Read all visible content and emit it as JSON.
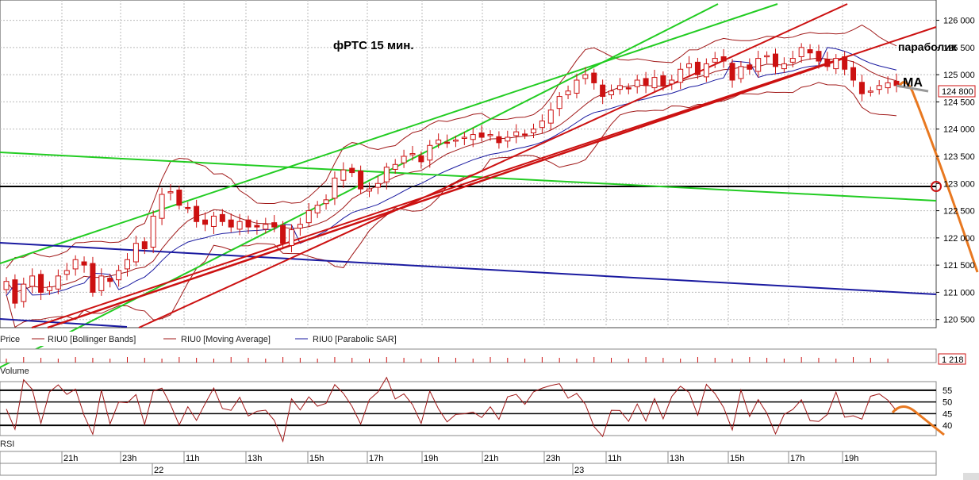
{
  "chart_data": {
    "type": "candlestick",
    "title": "фРТС   15 мин.",
    "annotations": {
      "parabolic": "параболик",
      "ma": "МА"
    },
    "price_axis": {
      "ylim": [
        120350,
        126300
      ],
      "ticks": [
        "126 000",
        "125 500",
        "125 000",
        "124 500",
        "124 000",
        "123 500",
        "123 000",
        "122 500",
        "122 000",
        "121 500",
        "121 000",
        "120 500"
      ],
      "tick_values": [
        126000,
        125500,
        125000,
        124500,
        124000,
        123500,
        123000,
        122500,
        122000,
        121500,
        121000,
        120500
      ],
      "last_price_label": "124 800",
      "last_price": 124800
    },
    "legend": [
      {
        "name": "RIU0 [Bollinger Bands]",
        "color": "#a01818"
      },
      {
        "name": "RIU0 [Moving Average]",
        "color": "#a01818"
      },
      {
        "name": "RIU0 [Parabolic SAR]",
        "color": "#1a1aa0"
      }
    ],
    "legend_price_label": "Price",
    "volume": {
      "label": "Volume",
      "value_label": "1 218"
    },
    "rsi": {
      "label": "RSI",
      "ticks": [
        "55",
        "50",
        "45",
        "40"
      ],
      "tick_values": [
        55,
        50,
        45,
        40
      ],
      "ylim": [
        36,
        58
      ]
    },
    "time_axis": {
      "hours": [
        "21h",
        "23h",
        "11h",
        "13h",
        "15h",
        "17h",
        "19h",
        "21h",
        "23h",
        "11h",
        "13h",
        "15h",
        "17h",
        "19h"
      ],
      "days": [
        "22",
        "23"
      ]
    },
    "candles_close": [
      121200,
      120800,
      121150,
      121300,
      121000,
      121100,
      121300,
      121400,
      121600,
      121500,
      121000,
      121300,
      121200,
      121400,
      121600,
      121900,
      121800,
      122400,
      122800,
      122850,
      122600,
      122550,
      122300,
      122250,
      122400,
      122300,
      122200,
      122300,
      122200,
      122200,
      122250,
      122200,
      121900,
      122150,
      122250,
      122500,
      122600,
      122700,
      123100,
      123250,
      123200,
      122900,
      122900,
      123000,
      123300,
      123350,
      123500,
      123550,
      123400,
      123700,
      123800,
      123750,
      123800,
      123850,
      123900,
      123850,
      123900,
      123750,
      123850,
      123950,
      123900,
      124000,
      124150,
      124350,
      124600,
      124700,
      124900,
      125000,
      124850,
      124600,
      124700,
      124800,
      124750,
      124900,
      124800,
      124950,
      124800,
      124900,
      125100,
      125200,
      125000,
      125200,
      125300,
      125250,
      124900,
      125150,
      125100,
      125300,
      125350,
      125150,
      125200,
      125300,
      125500,
      125400,
      125250,
      125150,
      125300,
      125100,
      124900,
      124650,
      124700,
      124800,
      124850,
      124800
    ],
    "colors": {
      "up": "#ffffff",
      "down": "#cc1111",
      "bollinger": "#a01818",
      "ma": "#a01818",
      "sar": "#1a1aa0",
      "trend_green": "#22cc22",
      "trend_red": "#cc1111",
      "trend_blue": "#1a1aa0",
      "forecast": "#e87820"
    }
  }
}
